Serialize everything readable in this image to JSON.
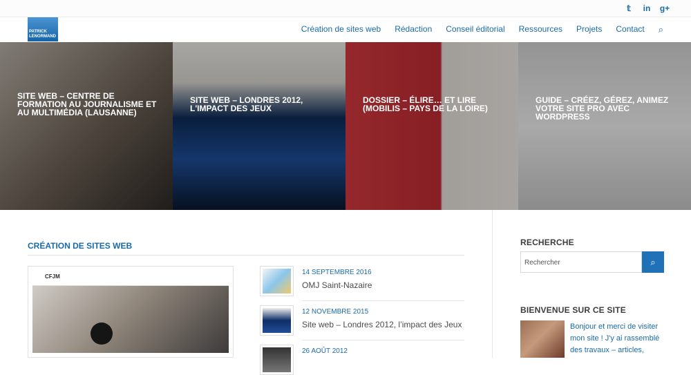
{
  "topbar": {
    "social": [
      "twitter-icon",
      "linkedin-icon",
      "google-plus-icon"
    ],
    "social_glyphs": [
      "𝕥",
      "in",
      "g+"
    ]
  },
  "logo": {
    "text": "PATRICK LENORMAND"
  },
  "nav": {
    "items": [
      "Création de sites web",
      "Rédaction",
      "Conseil éditorial",
      "Ressources",
      "Projets",
      "Contact"
    ],
    "search_glyph": "⌕"
  },
  "hero": {
    "slides": [
      {
        "title": "SITE WEB – CENTRE DE FORMATION AU JOURNALISME ET AU MULTIMÉDIA (LAUSANNE)"
      },
      {
        "title": "SITE WEB – LONDRES 2012, L'IMPACT DES JEUX"
      },
      {
        "title": "DOSSIER – ÉLIRE… ET LIRE (MOBILIS – PAYS DE LA LOIRE)"
      },
      {
        "title": "GUIDE – CRÉEZ, GÉREZ, ANIMEZ VOTRE SITE PRO AVEC WORDPRESS"
      }
    ]
  },
  "main": {
    "section_title": "CRÉATION DE SITES WEB",
    "featured": {
      "logo": "CFJM"
    },
    "news": [
      {
        "date": "14 SEPTEMBRE 2016",
        "title": "OMJ Saint-Nazaire"
      },
      {
        "date": "12 NOVEMBRE 2015",
        "title": "Site web – Londres 2012, l’impact des Jeux"
      },
      {
        "date": "26 AOÛT 2012",
        "title": ""
      }
    ]
  },
  "sidebar": {
    "search_heading": "RECHERCHE",
    "search_placeholder": "Rechercher",
    "search_button_glyph": "⌕",
    "welcome_heading": "BIENVENUE SUR CE SITE",
    "welcome_text": "Bonjour et merci de visiter mon site ! J'y ai rassemblé des travaux – articles,"
  }
}
